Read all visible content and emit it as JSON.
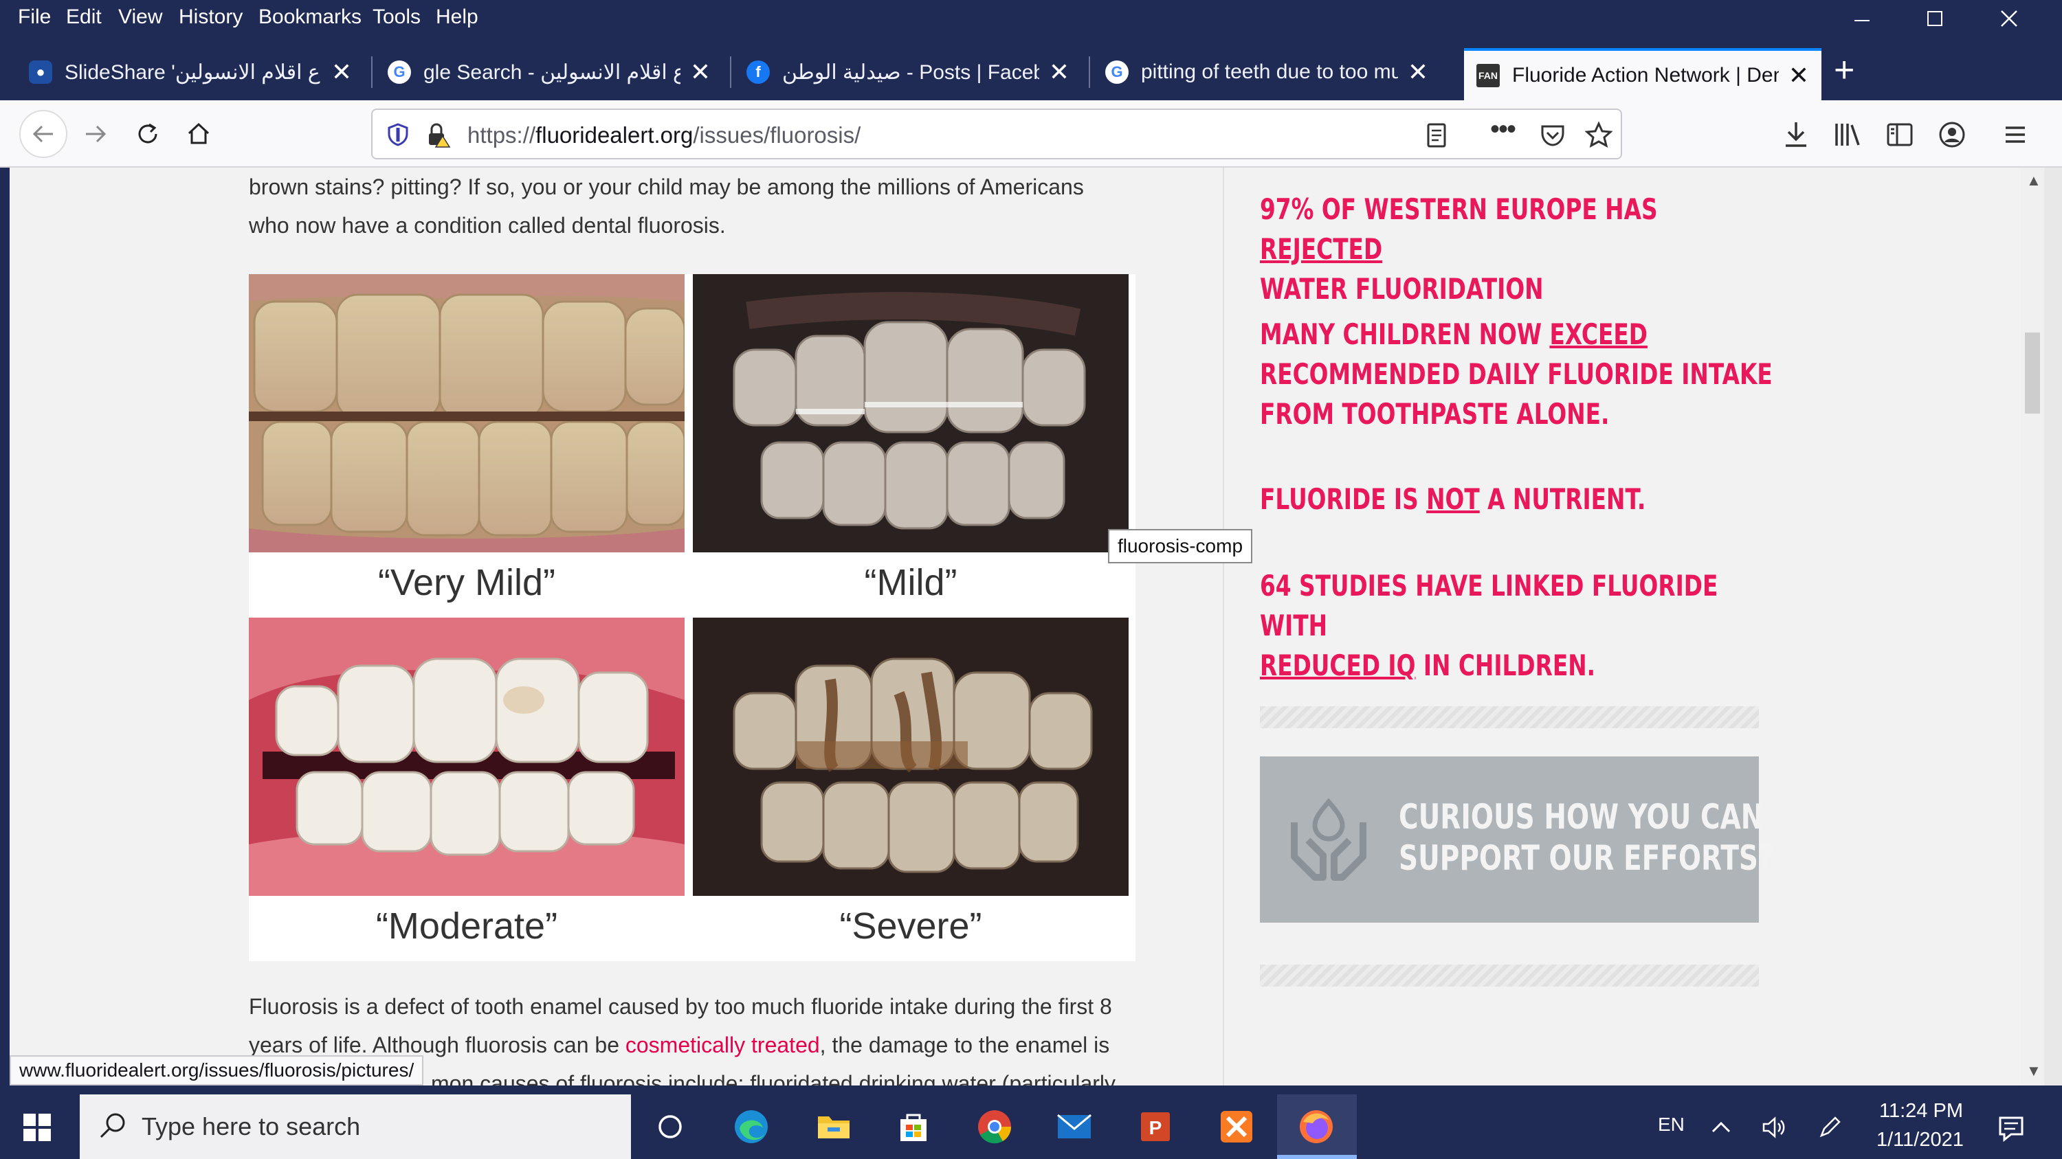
{
  "menubar": {
    "items": [
      "File",
      "Edit",
      "View",
      "History",
      "Bookmarks",
      "Tools",
      "Help"
    ]
  },
  "tabs": [
    {
      "title": "SlideShare 'انواع اقلام الانسولين'",
      "icon": "slideshare-icon"
    },
    {
      "title": "gle Search - انواع اقلام الانسولين",
      "icon": "google-icon"
    },
    {
      "title": "صيدلية الوطن - Posts | Faceboo",
      "icon": "facebook-icon"
    },
    {
      "title": "pitting of teeth due to too muc",
      "icon": "google-icon"
    },
    {
      "title": "Fluoride Action Network | Dent",
      "icon": "fan-icon",
      "favicon_text": "FAN"
    }
  ],
  "new_tab_label": "+",
  "url": {
    "scheme": "https://",
    "domain": "fluoridealert.org",
    "path": "/issues/fluorosis/"
  },
  "page": {
    "intro_line1": "brown stains? pitting? If so, you or your child may be among the millions of Americans",
    "intro_line2": "who now have a condition called dental fluorosis.",
    "figure": {
      "captions": [
        "“Very Mild”",
        "“Mild”",
        "“Moderate”",
        "“Severe”"
      ]
    },
    "tooltip": "fluorosis-comp",
    "para_line1": "Fluorosis is a defect of tooth enamel caused by too much fluoride intake during the first 8",
    "para_line2_a": "years of life. Although fluorosis can be ",
    "para_line2_link": "cosmetically treated",
    "para_line2_b": ", the damage to the enamel is",
    "para_line3": "mon causes of fluorosis include: fluoridated drinking water (particularly"
  },
  "sidebar": {
    "fact1_a": "97% OF WESTERN EUROPE HAS ",
    "fact1_u": "REJECTED",
    "fact1_b": " WATER FLUORIDATION",
    "fact2_a": "MANY CHILDREN NOW ",
    "fact2_u": "EXCEED",
    "fact2_b": " RECOMMENDED DAILY FLUORIDE INTAKE FROM TOOTHPASTE ALONE.",
    "fact3_a": "FLUORIDE IS ",
    "fact3_u": "NOT",
    "fact3_b": " A NUTRIENT.",
    "fact4_a": "64 STUDIES HAVE LINKED FLUORIDE WITH ",
    "fact4_u": "REDUCED IQ",
    "fact4_b": " IN CHILDREN.",
    "support_line1": "CURIOUS HOW YOU CAN",
    "support_line2": "SUPPORT OUR EFFORTS?"
  },
  "status_url": "www.fluoridealert.org/issues/fluorosis/pictures/",
  "taskbar": {
    "search_placeholder": "Type here to search",
    "lang": "EN",
    "time": "11:24 PM",
    "date": "1/11/2021"
  },
  "colors": {
    "accent": "#e8185a",
    "chrome": "#1f2a55",
    "tab_active_border": "#0a84ff"
  }
}
